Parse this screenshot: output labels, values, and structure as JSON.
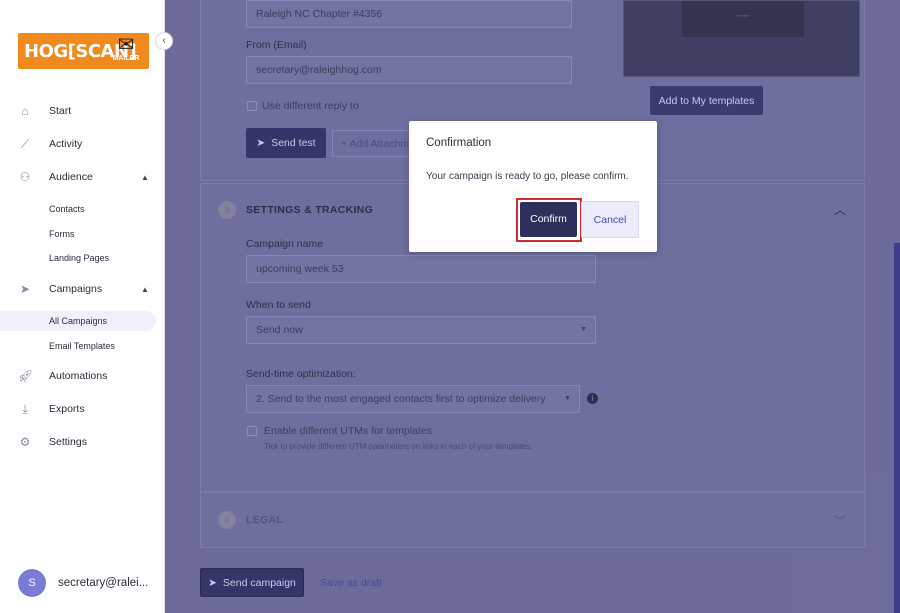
{
  "logo": {
    "brand": "HOG[SCAN]",
    "sub": "MAILER"
  },
  "nav": {
    "start": "Start",
    "activity": "Activity",
    "audience": "Audience",
    "contacts": "Contacts",
    "forms": "Forms",
    "landing_pages": "Landing Pages",
    "campaigns": "Campaigns",
    "all_campaigns": "All Campaigns",
    "email_templates": "Email Templates",
    "automations": "Automations",
    "exports": "Exports",
    "settings": "Settings"
  },
  "user": {
    "initial": "S",
    "name": "secretary@ralei..."
  },
  "form": {
    "from_name_value": "Raleigh NC Chapter #4356",
    "from_email_label": "From (Email)",
    "from_email_value": "secretary@raleighhog.com",
    "reply_to_label": "Use different reply to",
    "send_test": "Send test",
    "add_attachment": "Add Attachm",
    "add_to_templates": "Add to My templates"
  },
  "settings": {
    "step": "3",
    "title": "SETTINGS & TRACKING",
    "campaign_name_label": "Campaign name",
    "campaign_name_value": "upcoming week 53",
    "when_label": "When to send",
    "when_value": "Send now",
    "sto_label": "Send-time optimization:",
    "sto_value": "2. Send to the most engaged contacts first to optimize delivery",
    "utm_label": "Enable different UTMs for templates",
    "utm_hint": "Tick to provide different UTM parameters on links in each of your templates."
  },
  "legal": {
    "step": "4",
    "title": "LEGAL"
  },
  "footer": {
    "send_campaign": "Send campaign",
    "save_draft": "Save as draft"
  },
  "modal": {
    "title": "Confirmation",
    "message": "Your campaign is ready to go, please confirm.",
    "confirm": "Confirm",
    "cancel": "Cancel"
  },
  "colors": {
    "brand": "#f08a1c",
    "primary": "#2f2f5c",
    "highlight": "#d22a32"
  }
}
